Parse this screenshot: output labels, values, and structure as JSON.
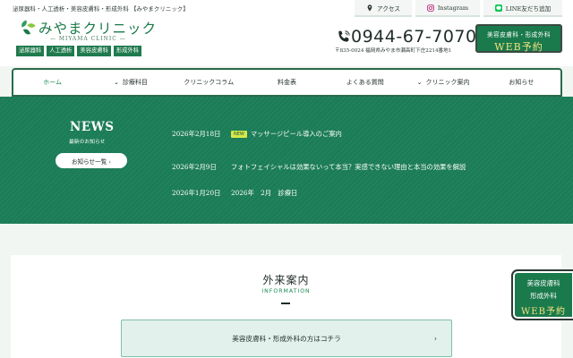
{
  "header": {
    "topline": "泌尿器科・人工透析・美容皮膚科・形成外科 【みやまクリニック】",
    "logo_title": "みやまクリニック",
    "logo_sub": "— MIYAMA CLINIC —",
    "departments": [
      "泌尿器科",
      "人工透析",
      "美容皮膚科",
      "形成外科"
    ],
    "utility": [
      {
        "label": "アクセス",
        "icon": "map-pin-icon"
      },
      {
        "label": "Instagram",
        "icon": "instagram-icon"
      },
      {
        "label": "LINE友だち追加",
        "icon": "line-icon"
      }
    ],
    "phone": "0944-67-7070",
    "address": "〒835-0024  福岡県みやま市瀬高町下庄2214番地1",
    "web_reserve": {
      "line1": "美容皮膚科・形成外科",
      "line2": "WEB予約"
    }
  },
  "nav": [
    {
      "label": "ホーム",
      "active": true
    },
    {
      "label": "診療科目"
    },
    {
      "label": "クリニックコラム"
    },
    {
      "label": "料金表"
    },
    {
      "label": "よくある質問"
    },
    {
      "label": "クリニック案内"
    },
    {
      "label": "お知らせ"
    }
  ],
  "news": {
    "title": "NEWS",
    "subtitle": "最新のお知らせ",
    "button": "お知らせ一覧 ›",
    "items": [
      {
        "date": "2026年2月18日",
        "badge": "NEW",
        "title": "マッサージピール導入のご案内"
      },
      {
        "date": "2026年2月9日",
        "badge": "",
        "title": "フォトフェイシャルは効果ないって本当？実感できない理由と本当の効果を解説"
      },
      {
        "date": "2026年1月20日",
        "badge": "",
        "title": "2026年　2月　診療日"
      }
    ]
  },
  "outpatient": {
    "title": "外来案内",
    "subtitle": "INFORMATION",
    "link": "美容皮膚科・形成外科の方はコチラ"
  },
  "float_reserve": {
    "line1": "美容皮膚科",
    "line2": "形成外科",
    "line3": "WEB予約"
  }
}
